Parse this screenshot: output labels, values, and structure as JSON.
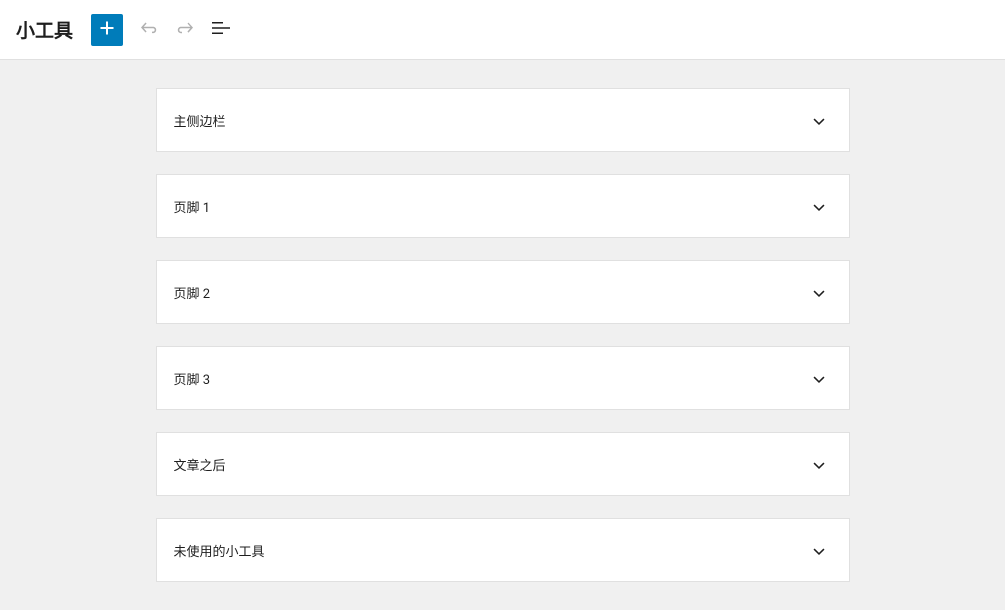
{
  "header": {
    "title": "小工具"
  },
  "widgetAreas": [
    {
      "label": "主侧边栏"
    },
    {
      "label": "页脚 1"
    },
    {
      "label": "页脚 2"
    },
    {
      "label": "页脚 3"
    },
    {
      "label": "文章之后"
    },
    {
      "label": "未使用的小工具"
    }
  ]
}
